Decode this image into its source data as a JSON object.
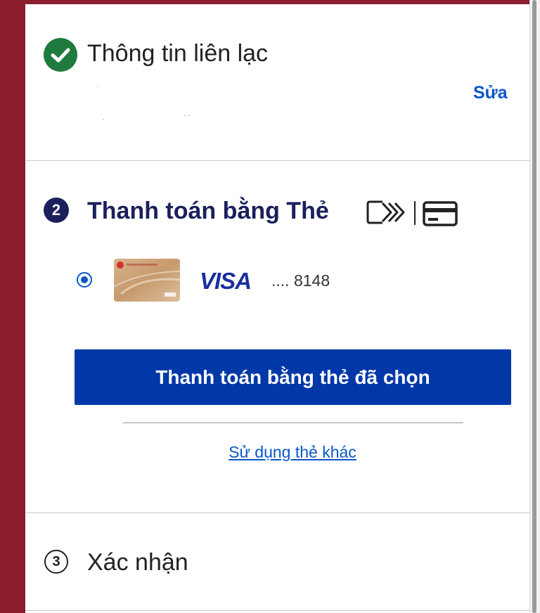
{
  "contact_section": {
    "title": "Thông tin liên lạc",
    "edit_label": "Sửa",
    "status_color": "#1f7a3e"
  },
  "payment_section": {
    "step_number": "2",
    "title": "Thanh toán bằng Thẻ",
    "icons": [
      "contactless-wallet-icon",
      "credit-card-icon"
    ],
    "selected_card": {
      "brand": "VISA",
      "masked_number": ".... 8148",
      "selected": true
    },
    "pay_button_label": "Thanh toán bằng thẻ đã chọn",
    "other_card_link": "Sử dụng thẻ khác",
    "accent_color": "#0038a8"
  },
  "confirm_section": {
    "step_number": "3",
    "title": "Xác nhận"
  }
}
